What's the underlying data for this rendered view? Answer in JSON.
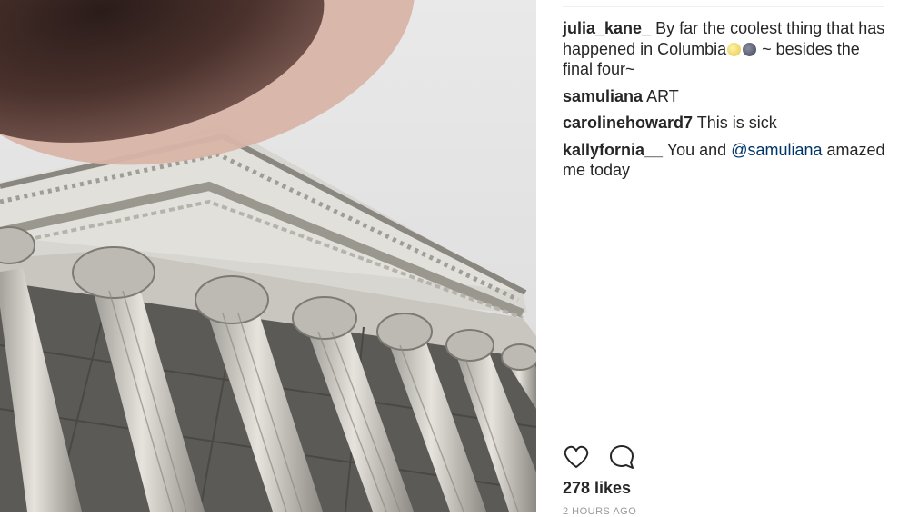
{
  "post": {
    "image": {
      "subject": "neoclassical building with columns",
      "overlay": "blurred finger"
    },
    "comments": [
      {
        "user": "julia_kane_",
        "text_before": "By far the coolest thing that has happened in Columbia",
        "emojis": [
          "yellow-moon-emoji",
          "dark-moon-emoji"
        ],
        "text_after": "~ besides the final four~"
      },
      {
        "user": "samuliana",
        "text": "ART"
      },
      {
        "user": "carolinehoward7",
        "text": "This is sick"
      },
      {
        "user": "kallyfornia__",
        "text_before": "You and",
        "mention": "@samuliana",
        "text_after": "amazed me today"
      }
    ],
    "actions": {
      "like_icon": "heart-icon",
      "comment_icon": "comment-icon"
    },
    "likes": "278 likes",
    "timestamp": "2 HOURS AGO"
  },
  "colors": {
    "mention": "#003569",
    "text": "#262626",
    "divider": "#efefef"
  }
}
